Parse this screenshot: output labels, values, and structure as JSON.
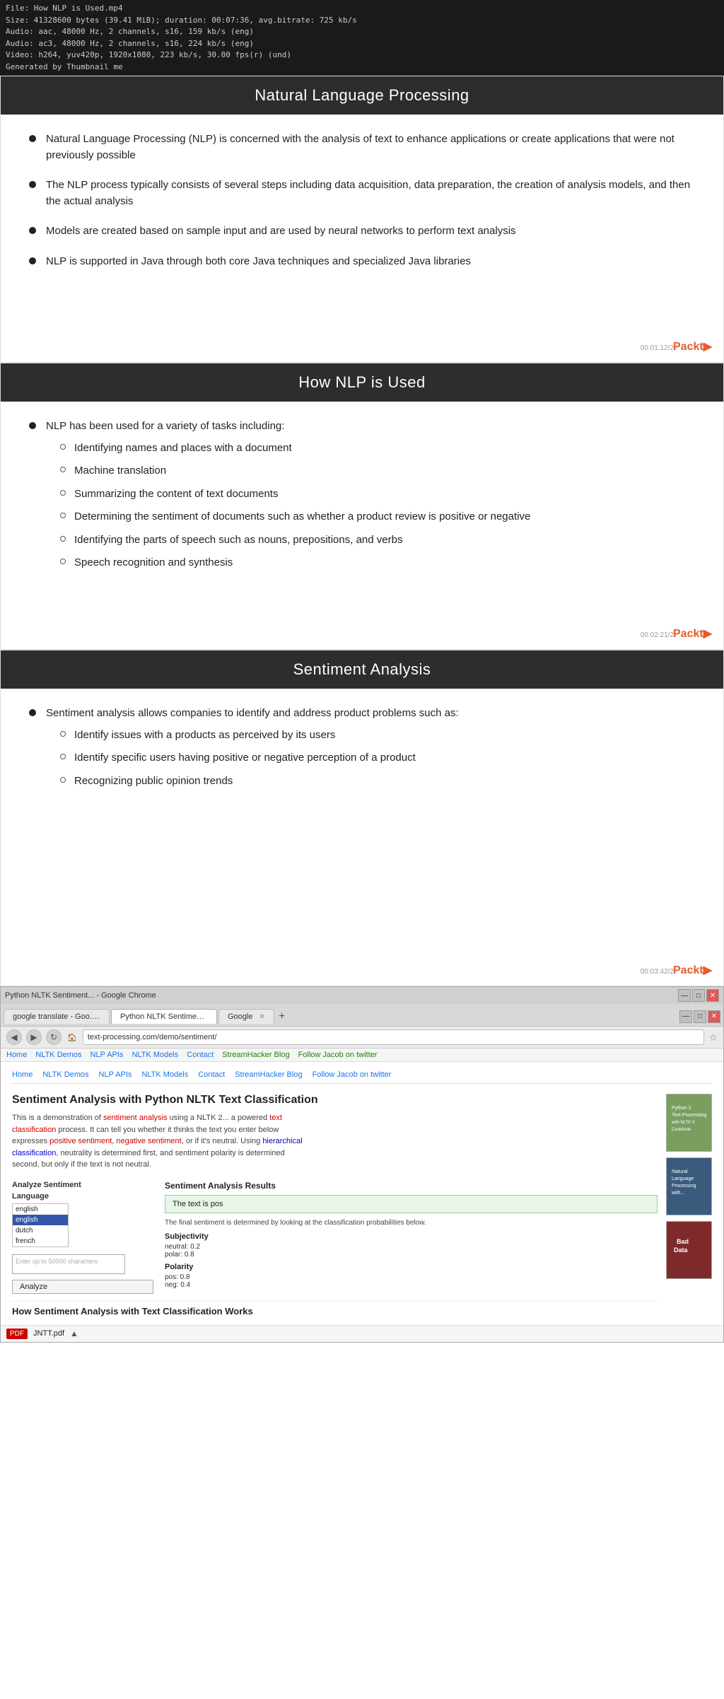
{
  "fileInfo": {
    "line1": "File: How NLP is Used.mp4",
    "line2": "Size: 41328600 bytes (39.41 MiB); duration: 00:07:36, avg.bitrate: 725 kb/s",
    "line3": "Audio: aac, 48000 Hz, 2 channels, s16, 159 kb/s (eng)",
    "line4": "Audio: ac3, 48000 Hz, 2 channels, s16, 224 kb/s (eng)",
    "line5": "Video: h264, yuv420p, 1920x1080, 223 kb/s, 30.00 fps(r) (und)",
    "line6": "Generated by Thumbnail me"
  },
  "slides": [
    {
      "id": "slide1",
      "title": "Natural Language Processing",
      "bullets": [
        "Natural Language Processing (NLP) is concerned with the analysis of text to enhance applications or create applications that were not previously possible",
        "The NLP process typically consists of several steps including data acquisition, data preparation, the creation of analysis models, and then the actual analysis",
        "Models are created based on sample input and are used by neural networks to perform text analysis",
        "NLP is supported in Java through both core Java techniques and specialized Java libraries"
      ],
      "timestamp": "00:01:12/2"
    },
    {
      "id": "slide2",
      "title": "How NLP is Used",
      "mainBullet": "NLP has been used for a variety of tasks including:",
      "subBullets": [
        "Identifying names and places with a document",
        "Machine translation",
        "Summarizing the content of text documents",
        "Determining the sentiment of documents such as whether a product review is positive or negative",
        "Identifying the parts of speech such as nouns, prepositions, and verbs",
        "Speech recognition and synthesis"
      ],
      "timestamp": "00:02:21/2"
    },
    {
      "id": "slide3",
      "title": "Sentiment Analysis",
      "mainBullet": "Sentiment analysis allows companies to identify and address product problems such as:",
      "subBullets": [
        "Identify issues with a products as perceived by its users",
        "Identify specific users having positive or negative perception of a product",
        "Recognizing public opinion trends"
      ],
      "timestamp": "00:03:42/2"
    }
  ],
  "packtLabel": "Packt▶",
  "browser": {
    "tabs": [
      {
        "label": "google translate - Goo...",
        "active": false
      },
      {
        "label": "Python NLTK Sentimen...",
        "active": true
      },
      {
        "label": "Google",
        "active": false
      }
    ],
    "addressBar": "text-processing.com/demo/sentiment/",
    "bookmarks": [
      "Home",
      "NLTK Demos",
      "NLP APIs",
      "NLTK Models",
      "Contact",
      "StreamHacker Blog",
      "Follow Jacob on twitter"
    ],
    "siteNav": [
      "Home",
      "NLTK Demos",
      "NLP APIs",
      "NLTK Models",
      "Contact",
      "StreamHacker Blog",
      "Follow Jacob on twitter"
    ],
    "pageTitle": "Sentiment Analysis with Python NLTK Text Classification",
    "pageDesc": "This is a demonstration of sentiment analysis using a NLTK 2... a powered text classification process. It can tell you whether it thinks the text you enter below expresses positive sentiment, negative sentiment, or if it's neutral. Using hierarchical classification, neutrality is determined first, and sentiment polarity is determined second, but only if the text is not neutral.",
    "formSection": {
      "analyzeLabel": "Analyze Sentiment",
      "languageLabel": "Language",
      "languages": [
        "english",
        "english",
        "dutch",
        "french"
      ],
      "selectedLang": "english",
      "textareaPlaceholder": "Enter up to 50000 characters",
      "analyzeButton": "Analyze"
    },
    "resultsSection": {
      "title": "Sentiment Analysis Results",
      "resultText": "The text is pos",
      "descText": "The final sentiment is determined by looking at the classification probabilities below.",
      "subjectivityLabel": "Subjectivity",
      "subjectivityValues": [
        "neutral: 0.2",
        "polar: 0.8"
      ],
      "polarityLabel": "Polarity",
      "polarityValues": [
        "pos: 0.8",
        "neg: 0.4"
      ]
    },
    "footerTitle": "How Sentiment Analysis with Text Classification Works",
    "bottomBar": {
      "pdfLabel": "JNTT.pdf"
    }
  }
}
